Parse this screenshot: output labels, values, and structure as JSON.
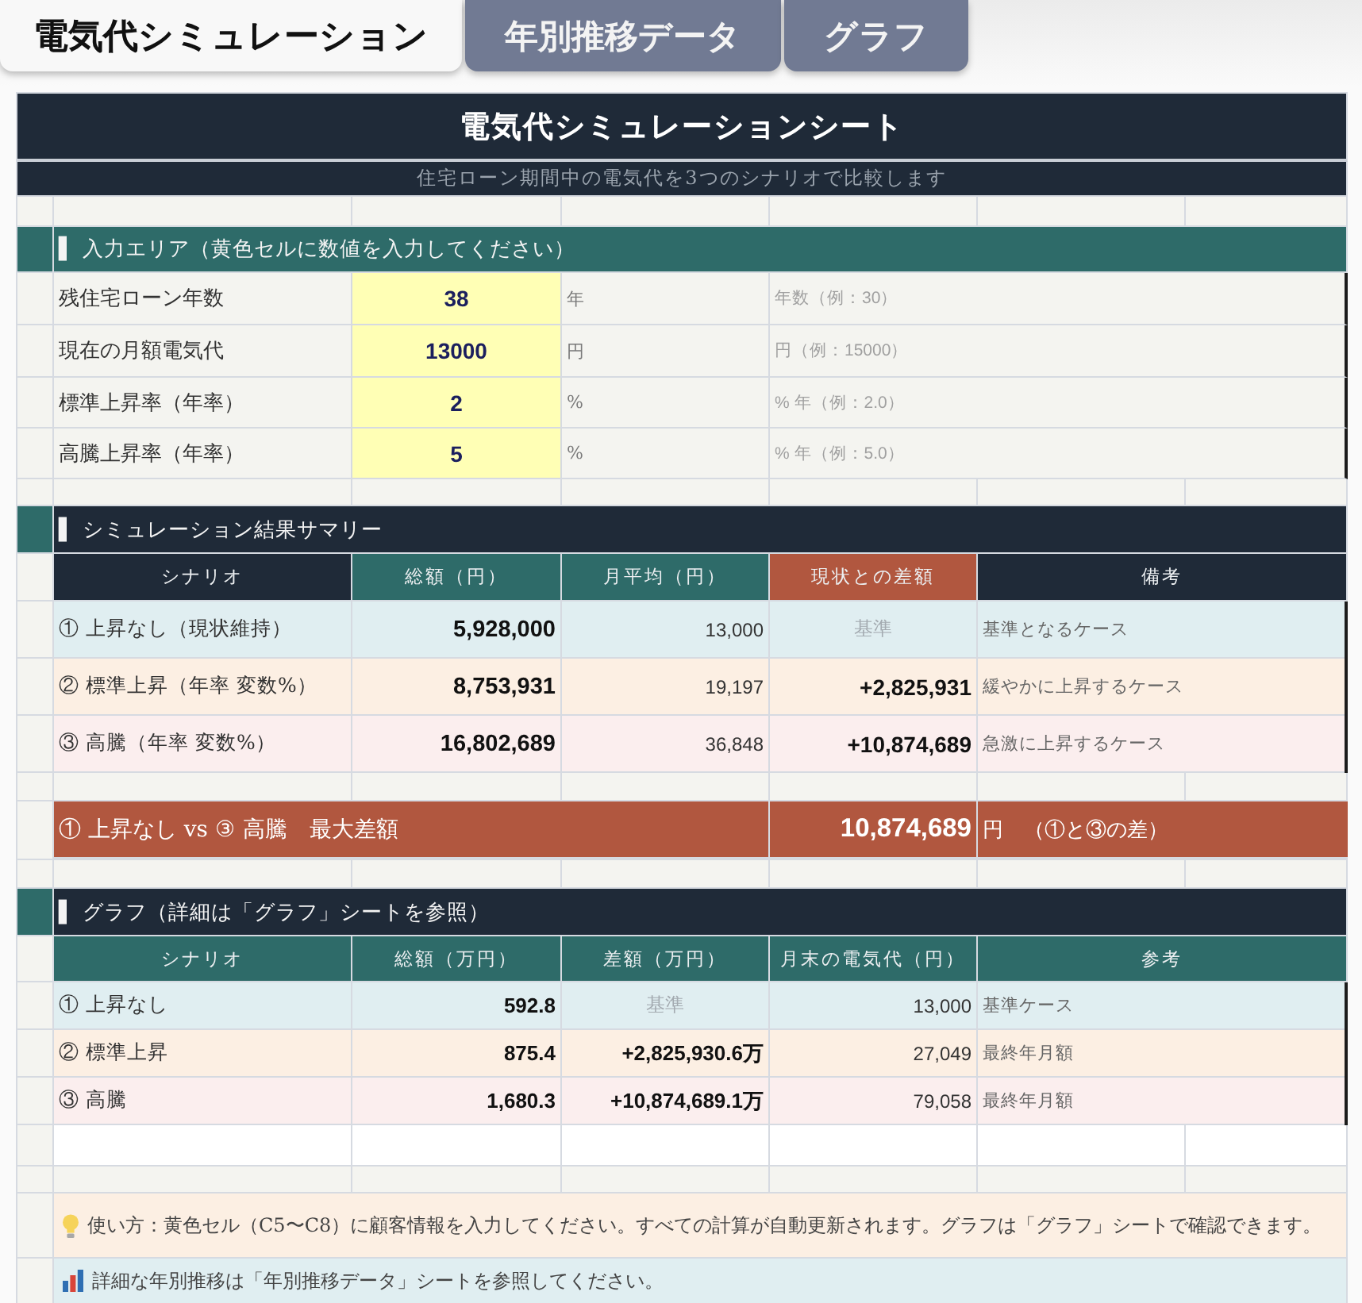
{
  "tabs": [
    {
      "label": "電気代シミュレーション",
      "selected": true
    },
    {
      "label": "年別推移データ",
      "selected": false
    },
    {
      "label": "グラフ",
      "selected": false
    }
  ],
  "sheet": {
    "title": "電気代シミュレーションシート",
    "subtitle": "住宅ローン期間中の電気代を3つのシナリオで比較します"
  },
  "sections": [
    {
      "kind": "input",
      "heading": "▌ 入力エリア（黄色セルに数値を入力してください）",
      "color": "#2e6b69",
      "rows": [
        {
          "label": "残住宅ローン年数",
          "value": "38",
          "unit": "年",
          "hint": "年数（例：30）"
        },
        {
          "label": "現在の月額電気代",
          "value": "13000",
          "unit": "円",
          "hint": "円（例：15000）"
        },
        {
          "label": "標準上昇率（年率）",
          "value": "2",
          "unit": "%",
          "hint": "% 年（例：2.0）"
        },
        {
          "label": "高騰上昇率（年率）",
          "value": "5",
          "unit": "%",
          "hint": "% 年（例：5.0）"
        }
      ]
    },
    {
      "kind": "summary",
      "heading": "▌ シミュレーション結果サマリー",
      "color": "#1f2a38",
      "columns": [
        {
          "label": "シナリオ",
          "color": "#1f2a38"
        },
        {
          "label": "総額（円）",
          "color": "#2e6b69"
        },
        {
          "label": "月平均（円）",
          "color": "#2e6b69"
        },
        {
          "label": "現状との差額",
          "color": "#b1573f"
        },
        {
          "label": "備考",
          "color": "#1f2a38"
        }
      ],
      "rows": [
        {
          "kind": "baseline",
          "color": "#e0eef1",
          "scenario": "① 上昇なし（現状維持）",
          "total": "5,928,000",
          "monthly": "13,000",
          "difference": "基準",
          "note": "基準となるケース"
        },
        {
          "kind": "increase",
          "color": "#fcefe3",
          "scenario": "② 標準上昇（年率 変数%）",
          "total": "8,753,931",
          "monthly": "19,197",
          "difference": "+2,825,931",
          "note": "緩やかに上昇するケース"
        },
        {
          "kind": "increase",
          "color": "#fbeeee",
          "scenario": "③ 高騰（年率 変数%）",
          "total": "16,802,689",
          "monthly": "36,848",
          "difference": "+10,874,689",
          "note": "急激に上昇するケース"
        }
      ],
      "highlight": {
        "label": "① 上昇なし vs ③ 高騰　最大差額",
        "value": "10,874,689",
        "unit": "円　（①と③の差）"
      }
    },
    {
      "kind": "graph",
      "heading": "▌ グラフ（詳細は「グラフ」シートを参照）",
      "color": "#1f2a38",
      "columns": [
        {
          "label": "シナリオ",
          "color": "#2e6b69"
        },
        {
          "label": "総額（万円）",
          "color": "#2e6b69"
        },
        {
          "label": "差額（万円）",
          "color": "#2e6b69"
        },
        {
          "label": "月末の電気代（円）",
          "color": "#2e6b69"
        },
        {
          "label": "参考",
          "color": "#2e6b69"
        }
      ],
      "rows": [
        {
          "kind": "baseline",
          "color": "#e0eef1",
          "scenario": "① 上昇なし",
          "total": "592.8",
          "difference": "基準",
          "month_end": "13,000",
          "note": "基準ケース"
        },
        {
          "kind": "increase",
          "color": "#fcefe3",
          "scenario": "② 標準上昇",
          "total": "875.4",
          "difference": "+2,825,930.6万",
          "month_end": "27,049",
          "note": "最終年月額"
        },
        {
          "kind": "increase",
          "color": "#fbeeee",
          "scenario": "③ 高騰",
          "total": "1,680.3",
          "difference": "+10,874,689.1万",
          "month_end": "79,058",
          "note": "最終年月額"
        }
      ]
    }
  ],
  "notes": [
    {
      "kind": "tip",
      "color": "#fcefe3",
      "text": "使い方：黄色セル（C5〜C8）に顧客情報を入力してください。すべての計算が自動更新されます。グラフは「グラフ」シートで確認できます。"
    },
    {
      "kind": "reference",
      "color": "#e0eef1",
      "text": "詳細な年別推移は「年別推移データ」シートを参照してください。"
    }
  ]
}
